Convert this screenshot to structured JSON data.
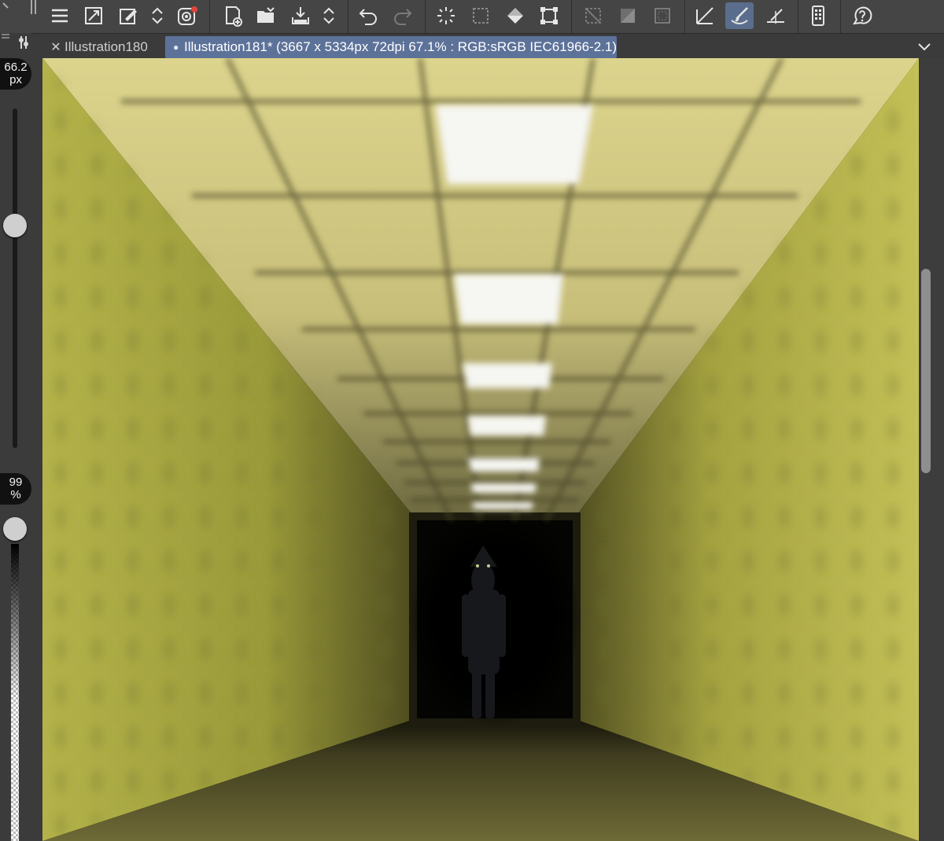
{
  "toolbar": {
    "icons": [
      "menu-icon",
      "resize-canvas-icon",
      "edit-eyedropper-icon",
      "expand-collapse-icon",
      "swirl-icon",
      "new-file-icon",
      "open-folder-icon",
      "save-icon",
      "save-menu-icon",
      "undo-icon",
      "redo-icon",
      "loading-selection-icon",
      "select-area-icon",
      "fill-icon",
      "transform-icon",
      "hide-selection-icon",
      "fill-selection-icon",
      "stroke-selection-icon",
      "ruler-snap-icon",
      "brush-icon",
      "ruler-icon",
      "quick-access-icon",
      "help-icon"
    ]
  },
  "brush_size": {
    "value": "66.2",
    "unit": "px",
    "level": 0.74
  },
  "brush_opacity": {
    "value": "99",
    "unit": "%",
    "level": 0.99
  },
  "tabs": [
    {
      "label": "Illustration180",
      "active": false
    },
    {
      "label": "Illustration181* (3667 x 5334px 72dpi 67.1% : RGB:sRGB IEC61966-2.1)",
      "active": true
    }
  ],
  "colors": {
    "accent": "#5d7299",
    "wall": "#a8a53a",
    "ceiling": "#d9d089",
    "floor": "#5e5a2e",
    "light": "#f6f6f2"
  }
}
